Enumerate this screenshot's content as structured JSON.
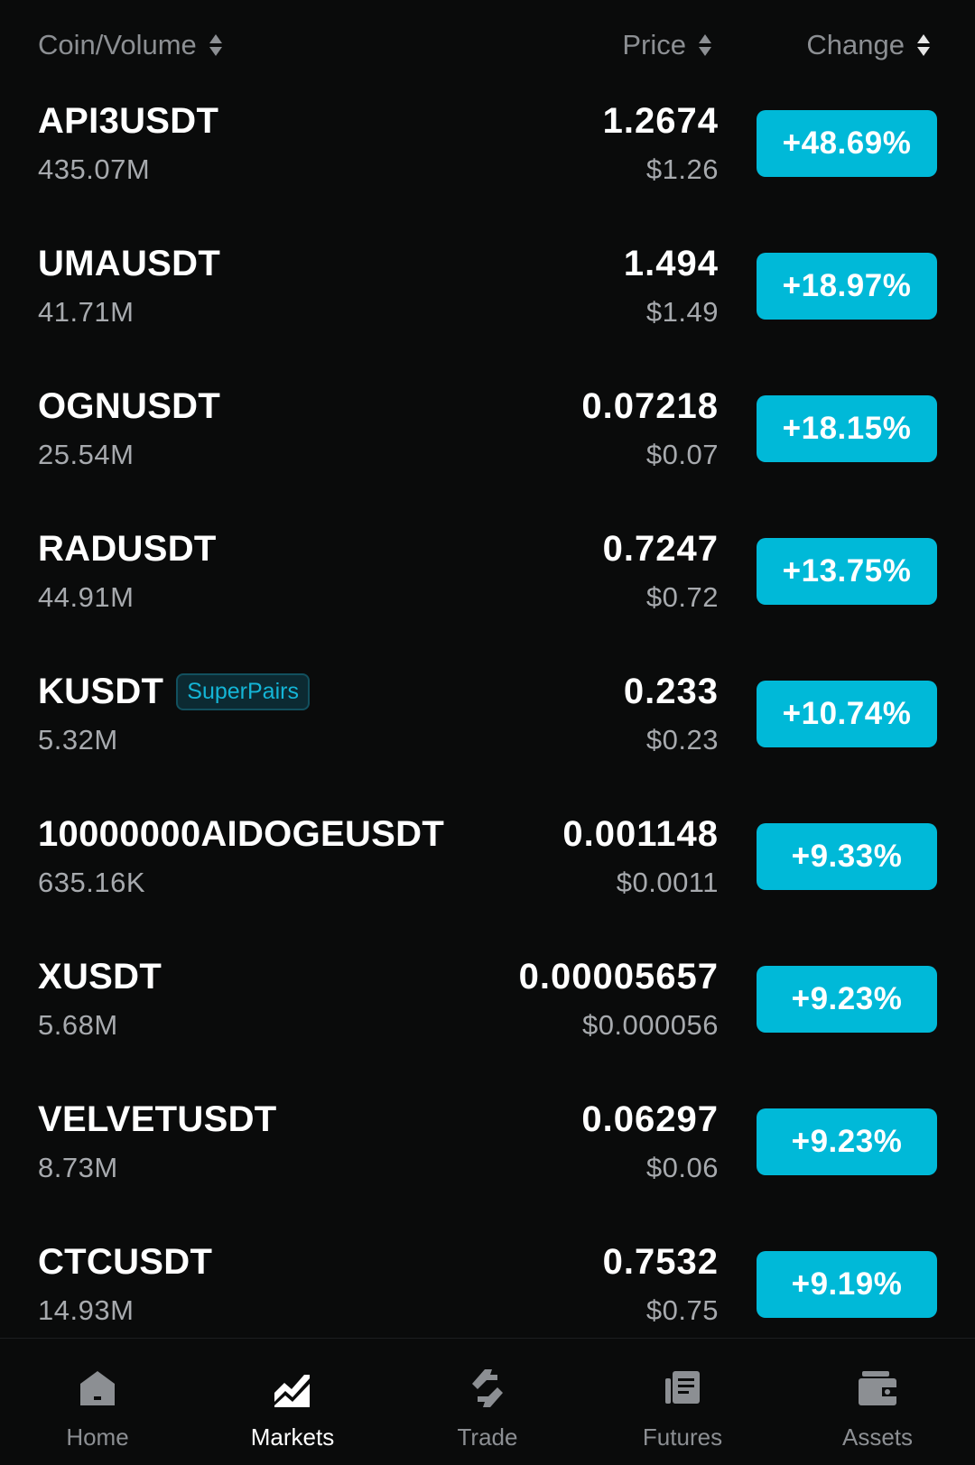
{
  "header": {
    "coin_volume": "Coin/Volume",
    "price": "Price",
    "change": "Change"
  },
  "rows": [
    {
      "symbol": "API3USDT",
      "volume": "435.07M",
      "price": "1.2674",
      "usd": "$1.26",
      "change": "+48.69%",
      "tag": ""
    },
    {
      "symbol": "UMAUSDT",
      "volume": "41.71M",
      "price": "1.494",
      "usd": "$1.49",
      "change": "+18.97%",
      "tag": ""
    },
    {
      "symbol": "OGNUSDT",
      "volume": "25.54M",
      "price": "0.07218",
      "usd": "$0.07",
      "change": "+18.15%",
      "tag": ""
    },
    {
      "symbol": "RADUSDT",
      "volume": "44.91M",
      "price": "0.7247",
      "usd": "$0.72",
      "change": "+13.75%",
      "tag": ""
    },
    {
      "symbol": "KUSDT",
      "volume": "5.32M",
      "price": "0.233",
      "usd": "$0.23",
      "change": "+10.74%",
      "tag": "SuperPairs"
    },
    {
      "symbol": "10000000AIDOGEUSDT",
      "volume": "635.16K",
      "price": "0.001148",
      "usd": "$0.0011",
      "change": "+9.33%",
      "tag": ""
    },
    {
      "symbol": "XUSDT",
      "volume": "5.68M",
      "price": "0.00005657",
      "usd": "$0.000056",
      "change": "+9.23%",
      "tag": ""
    },
    {
      "symbol": "VELVETUSDT",
      "volume": "8.73M",
      "price": "0.06297",
      "usd": "$0.06",
      "change": "+9.23%",
      "tag": ""
    },
    {
      "symbol": "CTCUSDT",
      "volume": "14.93M",
      "price": "0.7532",
      "usd": "$0.75",
      "change": "+9.19%",
      "tag": ""
    }
  ],
  "nav": {
    "items": [
      {
        "label": "Home",
        "icon": "home-icon",
        "active": false
      },
      {
        "label": "Markets",
        "icon": "markets-chart-icon",
        "active": true
      },
      {
        "label": "Trade",
        "icon": "trade-arrows-icon",
        "active": false
      },
      {
        "label": "Futures",
        "icon": "futures-icon",
        "active": false
      },
      {
        "label": "Assets",
        "icon": "wallet-icon",
        "active": false
      }
    ]
  },
  "colors": {
    "background": "#0a0b0b",
    "change_badge": "#00b9d8",
    "muted_text": "#8c8f93",
    "tag_text": "#14b5d6"
  }
}
